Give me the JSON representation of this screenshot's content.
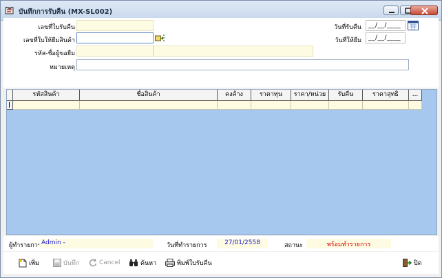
{
  "window": {
    "title": "บันทึกการรับคืน (MX-SL002)"
  },
  "form": {
    "receipt_no_label": "เลขที่ใบรับคืน",
    "receipt_no_value": "",
    "loan_no_label": "เลขที่ใบให้ยืมสินค้า",
    "loan_no_value": "",
    "borrower_label": "รหัส-ชื่อผู้ขอยืม",
    "borrower_code": "",
    "borrower_name": "",
    "note_label": "หมายเหตุ",
    "note_value": "",
    "receive_date_label": "วันที่รับคืน",
    "receive_date_value": "__/__/____",
    "loan_date_label": "วันที่ให้ยืม",
    "loan_date_value": "__/__/____"
  },
  "grid": {
    "columns": [
      "รหัสสินค้า",
      "ชื่อสินค้า",
      "คงค้าง",
      "ราคาทุน",
      "ราคา/หน่วย",
      "รับคืน",
      "ราคาสุทธิ",
      "..."
    ]
  },
  "status": {
    "user_label": "ผู้ทำรายการ",
    "user_value": "Admin -",
    "date_label": "วันที่ทำรายการ",
    "date_value": "27/01/2558",
    "state_label": "สถานะ",
    "state_value": "พร้อมทำรายการ",
    "state_color": "#e00000",
    "value_color": "#1a1acc"
  },
  "toolbar": {
    "add_label": "เพิ่ม",
    "save_label": "บันทึก",
    "cancel_label": "Cancel",
    "search_label": "ค้นหา",
    "print_label": "พิมพ์ใบรับคืน",
    "close_label": "ปิด"
  },
  "icons": [
    "app-icon",
    "minimize-icon",
    "maximize-icon",
    "close-icon",
    "calendar-icon",
    "lookup-icon",
    "new-doc-icon",
    "save-icon",
    "cancel-icon",
    "binoculars-icon",
    "printer-icon",
    "exit-icon"
  ]
}
